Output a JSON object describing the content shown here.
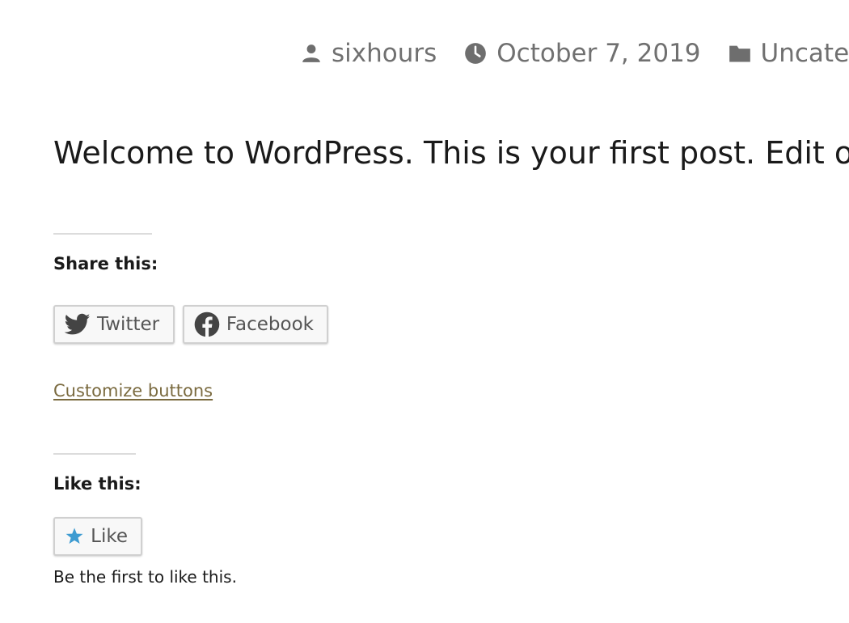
{
  "post_meta": {
    "author": "sixhours",
    "date": "October 7, 2019",
    "category": "Uncategorized"
  },
  "post_body": {
    "text": "Welcome to WordPress. This is your first post. Edit or delete it, then start writing!"
  },
  "share": {
    "heading": "Share this:",
    "twitter_label": "Twitter",
    "facebook_label": "Facebook",
    "customize_label": "Customize buttons"
  },
  "like": {
    "heading": "Like this:",
    "button_label": "Like",
    "note": "Be the first to like this."
  },
  "colors": {
    "meta_text": "#707070",
    "link": "#7a6a3f",
    "like_star": "#3d9bd1"
  }
}
